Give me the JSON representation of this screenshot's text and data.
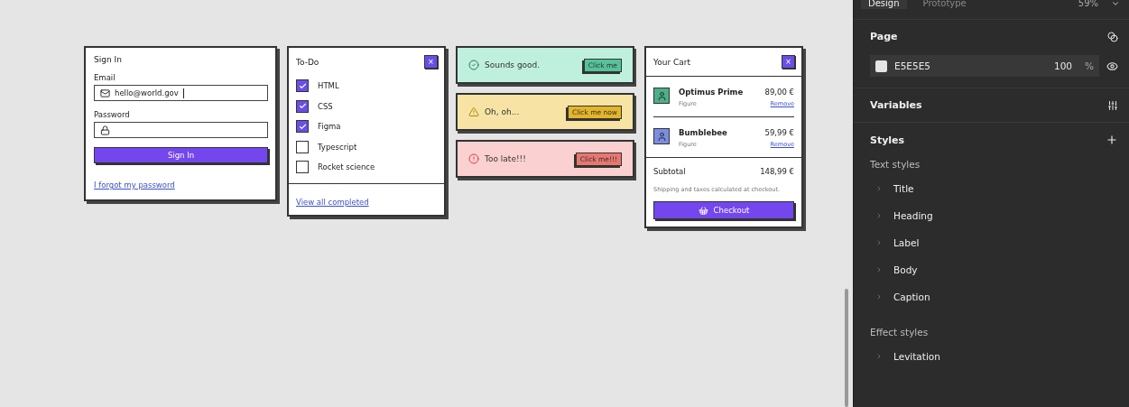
{
  "sign_in": {
    "title": "Sign In",
    "email_label": "Email",
    "email_value": "hello@world.gov",
    "password_label": "Password",
    "button": "Sign In",
    "link": "I forgot my password"
  },
  "todo": {
    "title": "To-Do",
    "close": "×",
    "items": [
      {
        "label": "HTML",
        "checked": true
      },
      {
        "label": "CSS",
        "checked": true
      },
      {
        "label": "Figma",
        "checked": true
      },
      {
        "label": "Typescript",
        "checked": false
      },
      {
        "label": "Rocket science",
        "checked": false
      }
    ],
    "link": "View all completed"
  },
  "alerts": [
    {
      "kind": "success",
      "message": "Sounds good.",
      "button": "Click me"
    },
    {
      "kind": "warning",
      "message": "Oh, oh...",
      "button": "Click me now"
    },
    {
      "kind": "error",
      "message": "Too late!!!",
      "button": "Click me!!!"
    }
  ],
  "cart": {
    "title": "Your Cart",
    "close": "×",
    "items": [
      {
        "name": "Optimus Prime",
        "type": "Figure",
        "price": "89,00 €",
        "remove": "Remove",
        "color": "#4caf8a"
      },
      {
        "name": "Bumblebee",
        "type": "Figure",
        "price": "59,99 €",
        "remove": "Remove",
        "color": "#7a8ee0"
      }
    ],
    "subtotal_label": "Subtotal",
    "subtotal": "148,99 €",
    "note": "Shipping and taxes calculated at checkout.",
    "checkout": "Checkout"
  },
  "panel": {
    "tabs": [
      {
        "label": "Design",
        "selected": true
      },
      {
        "label": "Prototype",
        "selected": false
      }
    ],
    "zoom": "59%",
    "page_title": "Page",
    "fill_hex": "E5E5E5",
    "fill_opacity": "100",
    "percent": "%",
    "variables": "Variables",
    "styles": "Styles",
    "text_styles_title": "Text styles",
    "text_styles": [
      "Title",
      "Heading",
      "Label",
      "Body",
      "Caption"
    ],
    "effect_styles_title": "Effect styles",
    "effect_styles": [
      "Levitation"
    ]
  }
}
